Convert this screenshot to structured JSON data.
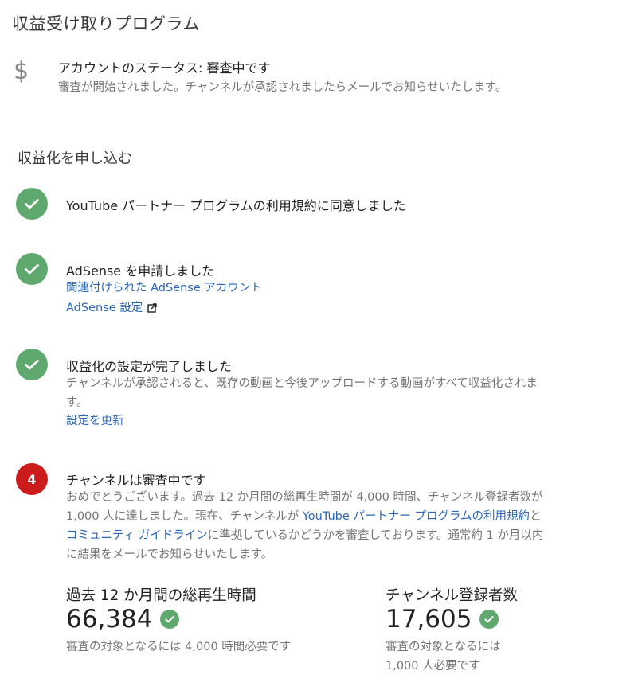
{
  "page": {
    "title": "収益受け取りプログラム"
  },
  "account": {
    "icon": "dollar-icon",
    "status_title": "アカウントのステータス: 審査中です",
    "status_desc": "審査が開始されました。チャンネルが承認されましたらメールでお知らせいたします。"
  },
  "section": {
    "title": "収益化を申し込む"
  },
  "steps": [
    {
      "state": "done",
      "title": "YouTube パートナー プログラムの利用規約に同意しました"
    },
    {
      "state": "done",
      "title": "AdSense を申請しました",
      "links": [
        "関連付けられた AdSense アカウント",
        "AdSense 設定"
      ]
    },
    {
      "state": "done",
      "title": "収益化の設定が完了しました",
      "desc": "チャンネルが承認されると、既存の動画と今後アップロードする動画がすべて収益化されます。",
      "link": "設定を更新"
    },
    {
      "state": "current",
      "number": "4",
      "title": "チャンネルは審査中です",
      "desc_parts": [
        "おめでとうございます。過去 12 か月間の総再生時間が 4,000 時間、チャンネル登録者数が 1,000 人に達しました。現在、チャンネルが ",
        "YouTube パートナー プログラムの利用規約",
        "と",
        "コミュニティ ガイドライン",
        "に準拠しているかどうかを審査しております。通常約 1 か月以内に結果をメールでお知らせいたします。"
      ]
    }
  ],
  "stats": [
    {
      "label": "過去 12 か月間の総再生時間",
      "value": "66,384",
      "note": "審査の対象となるには 4,000 時間必要です"
    },
    {
      "label": "チャンネル登録者数",
      "value": "17,605",
      "note": "審査の対象となるには 1,000 人必要です"
    }
  ],
  "colors": {
    "success": "#5fa96f",
    "alert": "#cc1b1b",
    "link": "#2a66b5"
  }
}
